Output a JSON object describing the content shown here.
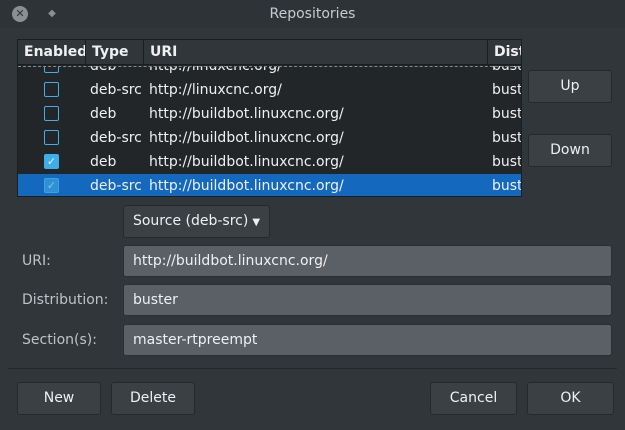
{
  "window": {
    "title": "Repositories"
  },
  "table": {
    "columns": [
      "Enabled",
      "Type",
      "URI",
      "Dist"
    ],
    "rows": [
      {
        "enabled": false,
        "type": "deb",
        "uri": "http://linuxcnc.org/",
        "dist": "buster"
      },
      {
        "enabled": false,
        "type": "deb-src",
        "uri": "http://linuxcnc.org/",
        "dist": "buster"
      },
      {
        "enabled": false,
        "type": "deb",
        "uri": "http://buildbot.linuxcnc.org/",
        "dist": "buster"
      },
      {
        "enabled": false,
        "type": "deb-src",
        "uri": "http://buildbot.linuxcnc.org/",
        "dist": "buster"
      },
      {
        "enabled": true,
        "type": "deb",
        "uri": "http://buildbot.linuxcnc.org/",
        "dist": "buster"
      },
      {
        "enabled": true,
        "type": "deb-src",
        "uri": "http://buildbot.linuxcnc.org/",
        "dist": "buster",
        "selected": true
      }
    ]
  },
  "side_buttons": {
    "up": "Up",
    "down": "Down"
  },
  "source_dropdown": {
    "selected": "Source (deb-src)"
  },
  "form": {
    "uri": {
      "label": "URI:",
      "value": "http://buildbot.linuxcnc.org/"
    },
    "distribution": {
      "label": "Distribution:",
      "value": "buster"
    },
    "sections": {
      "label": "Section(s):",
      "value": "master-rtpreempt"
    }
  },
  "footer": {
    "new": "New",
    "delete": "Delete",
    "cancel": "Cancel",
    "ok": "OK"
  },
  "colors": {
    "accent": "#3daee9",
    "selection": "#1468be",
    "background": "#31363b"
  }
}
